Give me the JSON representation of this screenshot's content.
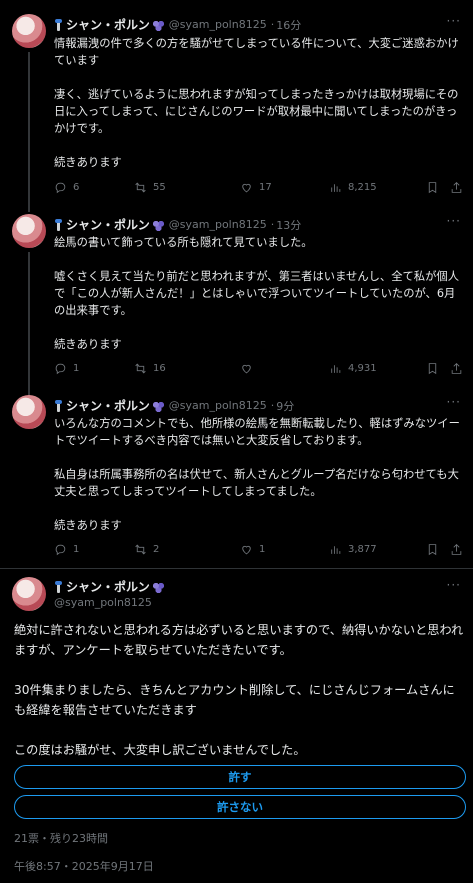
{
  "author": {
    "name": "シャン・ポルン",
    "handle": "@syam_poln8125"
  },
  "tweets": [
    {
      "time": "16分",
      "text": "情報漏洩の件で多くの方を騒がせてしまっている件について、大変ご迷惑おかけています\n\n凄く、逃げているように思われますが知ってしまったきっかけは取材現場にその日に入ってしまって、にじさんじのワードが取材最中に聞いてしまったのがきっかけです。\n\n続きあります",
      "replies": "6",
      "retweets": "55",
      "likes": "17",
      "views": "8,215"
    },
    {
      "time": "13分",
      "text": "絵馬の書いて飾っている所も隠れて見ていました。\n\n嘘くさく見えて当たり前だと思われますが、第三者はいませんし、全て私が個人で「この人が新人さんだ！」とはしゃいで浮ついてツイートしていたのが、6月の出来事です。\n\n続きあります",
      "replies": "1",
      "retweets": "16",
      "likes": "",
      "views": "4,931"
    },
    {
      "time": "9分",
      "text": "いろんな方のコメントでも、他所様の絵馬を無断転載したり、軽はずみなツイートでツイートするべき内容では無いと大変反省しております。\n\n私自身は所属事務所の名は伏せて、新人さんとグループ名だけなら匂わせても大丈夫と思ってしまってツイートしてしまってました。\n\n続きあります",
      "replies": "1",
      "retweets": "2",
      "likes": "1",
      "views": "3,877"
    }
  ],
  "main_tweet": {
    "text": "絶対に許されないと思われる方は必ずいると思いますので、納得いかないと思われますが、アンケートを取らせていただきたいです。\n\n30件集まりましたら、きちんとアカウント削除して、にじさんじフォームさんにも経緯を報告させていただきます\n\nこの度はお騒がせ、大変申し訳ございませんでした。",
    "poll_options": [
      "許す",
      "許さない"
    ],
    "poll_meta": "21票・残り23時間",
    "timestamp": "午後8:57・2025年9月17日"
  },
  "more_label": "···"
}
